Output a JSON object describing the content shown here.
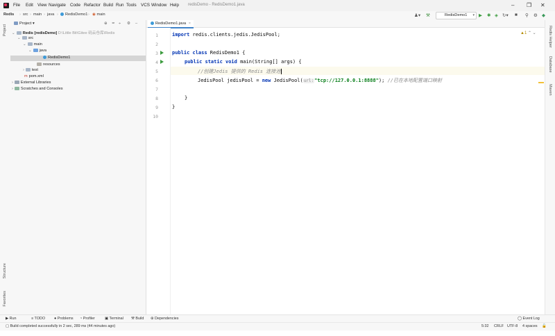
{
  "menubar": {
    "items": [
      "File",
      "Edit",
      "View",
      "Navigate",
      "Code",
      "Refactor",
      "Build",
      "Run",
      "Tools",
      "VCS",
      "Window",
      "Help"
    ],
    "window_title": "redisDemo - RedisDemo1.java"
  },
  "navbar": {
    "crumbs": [
      "Redis",
      "src",
      "main",
      "java",
      "RedisDemo1",
      "main"
    ],
    "run_config": "RedisDemo1"
  },
  "project_panel": {
    "title": "Project",
    "tree": [
      {
        "label": "Redis [redisDemo]",
        "path": "D:\\Little Bit\\Gitee 码云仓库\\Redis"
      },
      {
        "label": "src"
      },
      {
        "label": "main"
      },
      {
        "label": "java"
      },
      {
        "label": "RedisDemo1"
      },
      {
        "label": "resources"
      },
      {
        "label": "test"
      },
      {
        "label": "pom.xml"
      },
      {
        "label": "External Libraries"
      },
      {
        "label": "Scratches and Consoles"
      }
    ]
  },
  "editor": {
    "tab": "RedisDemo1.java",
    "line_numbers": [
      "1",
      "2",
      "3",
      "4",
      "5",
      "6",
      "7",
      "8",
      "9",
      "10"
    ],
    "line1": {
      "kw": "import",
      "rest": " redis.clients.jedis.JedisPool;"
    },
    "line3": {
      "kw": "public class",
      "rest": " RedisDemo1 {"
    },
    "line4": {
      "kw": "public static void",
      "rest": " main(String[] args) {"
    },
    "line5": {
      "comment": "//创建Jedis 提供的 Redis 连接池"
    },
    "line6": {
      "pre": "JedisPool jedisPool = ",
      "kw": "new",
      "mid": " JedisPool(",
      "hint": "url:",
      "str": "\"tcp://127.0.0.1:8888\"",
      "post": "); ",
      "comment": "//已在本地配置端口映射"
    },
    "line8": "}",
    "line9": "}",
    "warnings": "1"
  },
  "right_strip": [
    "Redis Helper",
    "Database",
    "Maven"
  ],
  "left_strip": [
    "Project",
    "Structure",
    "Favorites"
  ],
  "bottom_tools": [
    "Run",
    "TODO",
    "Problems",
    "Profiler",
    "Terminal",
    "Build",
    "Dependencies"
  ],
  "event_log": "Event Log",
  "status": {
    "message": "Build completed successfully in 2 sec, 289 ms (44 minutes ago)",
    "position": "5:32",
    "line_sep": "CRLF",
    "encoding": "UTF-8",
    "indent": "4 spaces"
  }
}
